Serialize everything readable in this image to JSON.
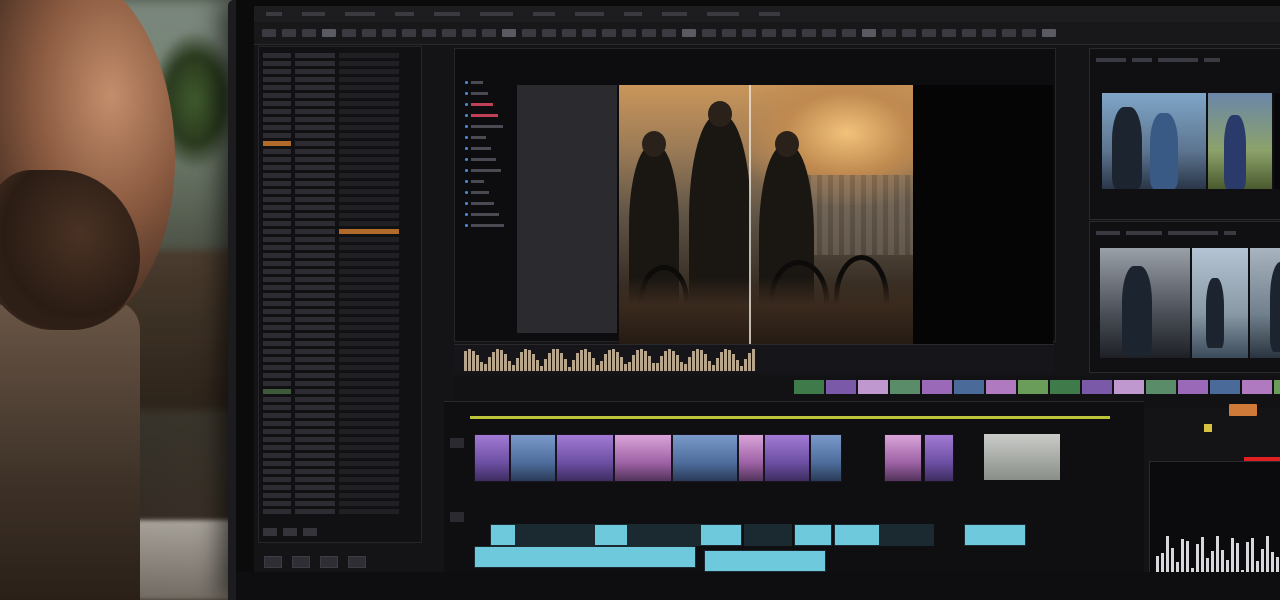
{
  "scene": {
    "person": "editor",
    "setting": "home studio"
  },
  "app": {
    "menubar": [
      "",
      "",
      "",
      "",
      "",
      "",
      "",
      "",
      "",
      "",
      "",
      ""
    ],
    "viewer": {
      "tree_items": 14
    },
    "colors": {
      "accent_playhead": "#bcc43a",
      "video_clip_purple": "#a27bd4",
      "video_clip_blue": "#7a9acb",
      "audio_clip_cyan": "#6fc9dc",
      "record_red": "#e02020",
      "marker_orange": "#d07a3a"
    },
    "icons": {
      "transport": [
        "play-icon",
        "stop-icon",
        "loop-icon",
        "skip-icon"
      ]
    }
  }
}
